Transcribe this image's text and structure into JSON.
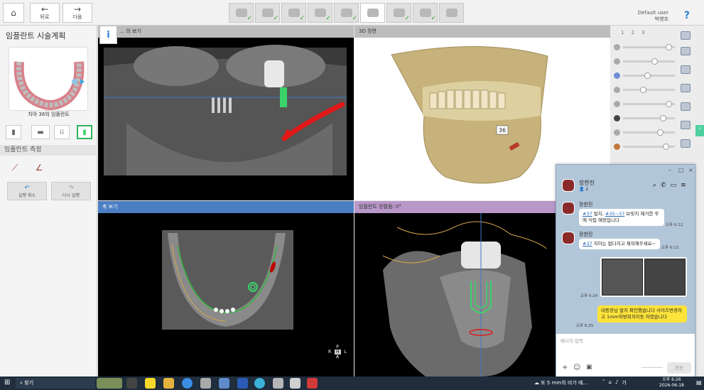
{
  "toolbar": {
    "home_icon": "home-icon",
    "back_label": "뒤로",
    "next_label": "다음",
    "steps": [
      {
        "icon": "scan-step-icon",
        "done": true
      },
      {
        "icon": "nerve-step-icon",
        "done": true
      },
      {
        "icon": "segment-step-icon",
        "done": true
      },
      {
        "icon": "crown-step-icon",
        "done": true
      },
      {
        "icon": "arch-step-icon",
        "done": true
      },
      {
        "icon": "implant-step-icon",
        "done": false,
        "active": true
      },
      {
        "icon": "sleeve-step-icon",
        "done": true
      },
      {
        "icon": "guide-step-icon",
        "done": true
      },
      {
        "icon": "export-step-icon",
        "done": false
      }
    ],
    "user_name": "Default user",
    "user_sub": "박병호",
    "help": "?"
  },
  "left": {
    "title": "임플란트 시술계획",
    "caption": "치아 36의 임플란트",
    "measure_title": "임플란트 측정",
    "undo_label": "실행 취소",
    "redo_label": "다시 실행"
  },
  "views": {
    "panoramic_title": "… 의 보기",
    "d3_title": "3D 장면",
    "axial_title": "축 보기",
    "implant_title": "임플란트 정렬됨: 0°",
    "tooth_label": "36",
    "orient": {
      "p": "P",
      "r": "R",
      "h": "H",
      "l": "L",
      "a": "A"
    }
  },
  "layers": {
    "tabs": [
      "1",
      "2",
      "3"
    ]
  },
  "chat": {
    "room_name": "장한진",
    "member_count": "2",
    "messages": [
      {
        "sender": "장한진",
        "link1": "#37",
        "text1": " 발치, ",
        "link2": "#35~37",
        "text2": " 브릿지 제거한 후에 식립 예정입니다",
        "time": "오후 6:12"
      },
      {
        "sender": "장한진",
        "link1": "#37",
        "text1": " 치아는 없다치고 제작해주세요~",
        "time": "오후 6:13"
      },
      {
        "image_time": "오후 6:24"
      },
      {
        "mine": true,
        "text": "네등장님 발치 확인했습니다 사이즈변경하고 1mm허방위치이동 하였습니다",
        "time": "오후 6:25"
      }
    ],
    "input_placeholder": "메시지 입력",
    "send_label": "전송"
  },
  "taskbar": {
    "search_label": "찾기",
    "weather": "또 5 mm의 비가 예...",
    "lang": "가",
    "time": "오후 6:26",
    "date": "2026-06-18"
  },
  "colors": {
    "accent_blue": "#2f7fd0",
    "implant_green": "#3ad36a",
    "nerve_red": "#e01818",
    "axial_head": "#4b7ec2",
    "implant_head": "#b998c9",
    "yellow_bubble": "#fde33a"
  }
}
